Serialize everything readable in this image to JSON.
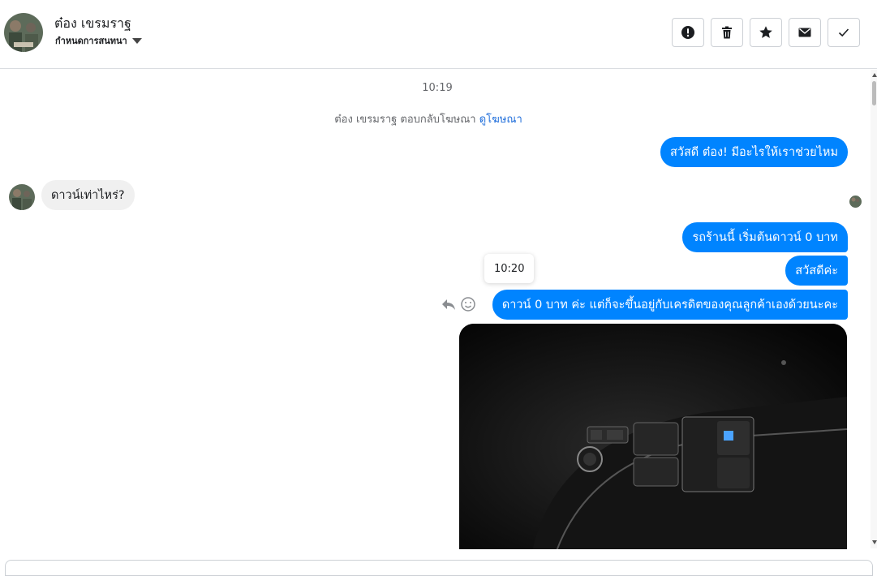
{
  "header": {
    "contact_name": "ต๋อง เขรมราฐ",
    "label_dropdown": "กำหนดการสนทนา",
    "actions": [
      {
        "name": "report-spam-button",
        "icon": "exclamation-icon"
      },
      {
        "name": "delete-button",
        "icon": "trash-icon"
      },
      {
        "name": "star-button",
        "icon": "star-icon"
      },
      {
        "name": "mark-unread-button",
        "icon": "envelope-icon"
      },
      {
        "name": "mark-done-button",
        "icon": "checkmark-icon"
      }
    ]
  },
  "thread": {
    "time_1": "10:19",
    "ad_reply_text": "ต๋อง เขรมราฐ ตอบกลับโฆษณา",
    "ad_link": "ดูโฆษณา",
    "messages": [
      {
        "from": "page",
        "text": "สวัสดี ต๋อง! มีอะไรให้เราช่วยไหม"
      },
      {
        "from": "contact",
        "text": "ดาวน์เท่าไหร่?"
      },
      {
        "from": "page",
        "text": "รถร้านนี้ เริ่มต้นดาวน์ 0 บาท"
      },
      {
        "from": "page",
        "text": "สวัสดีค่ะ"
      },
      {
        "from": "page",
        "text": "ดาวน์ 0 บาท ค่ะ แต่ก็จะขึ้นอยู่กับเครดิตของคุณลูกค้าเองด้วยนะคะ"
      }
    ],
    "hover_time": "10:20"
  },
  "colors": {
    "outgoing_bubble": "#0084ff",
    "incoming_bubble": "#f0f0f0",
    "link": "#216fdb"
  }
}
